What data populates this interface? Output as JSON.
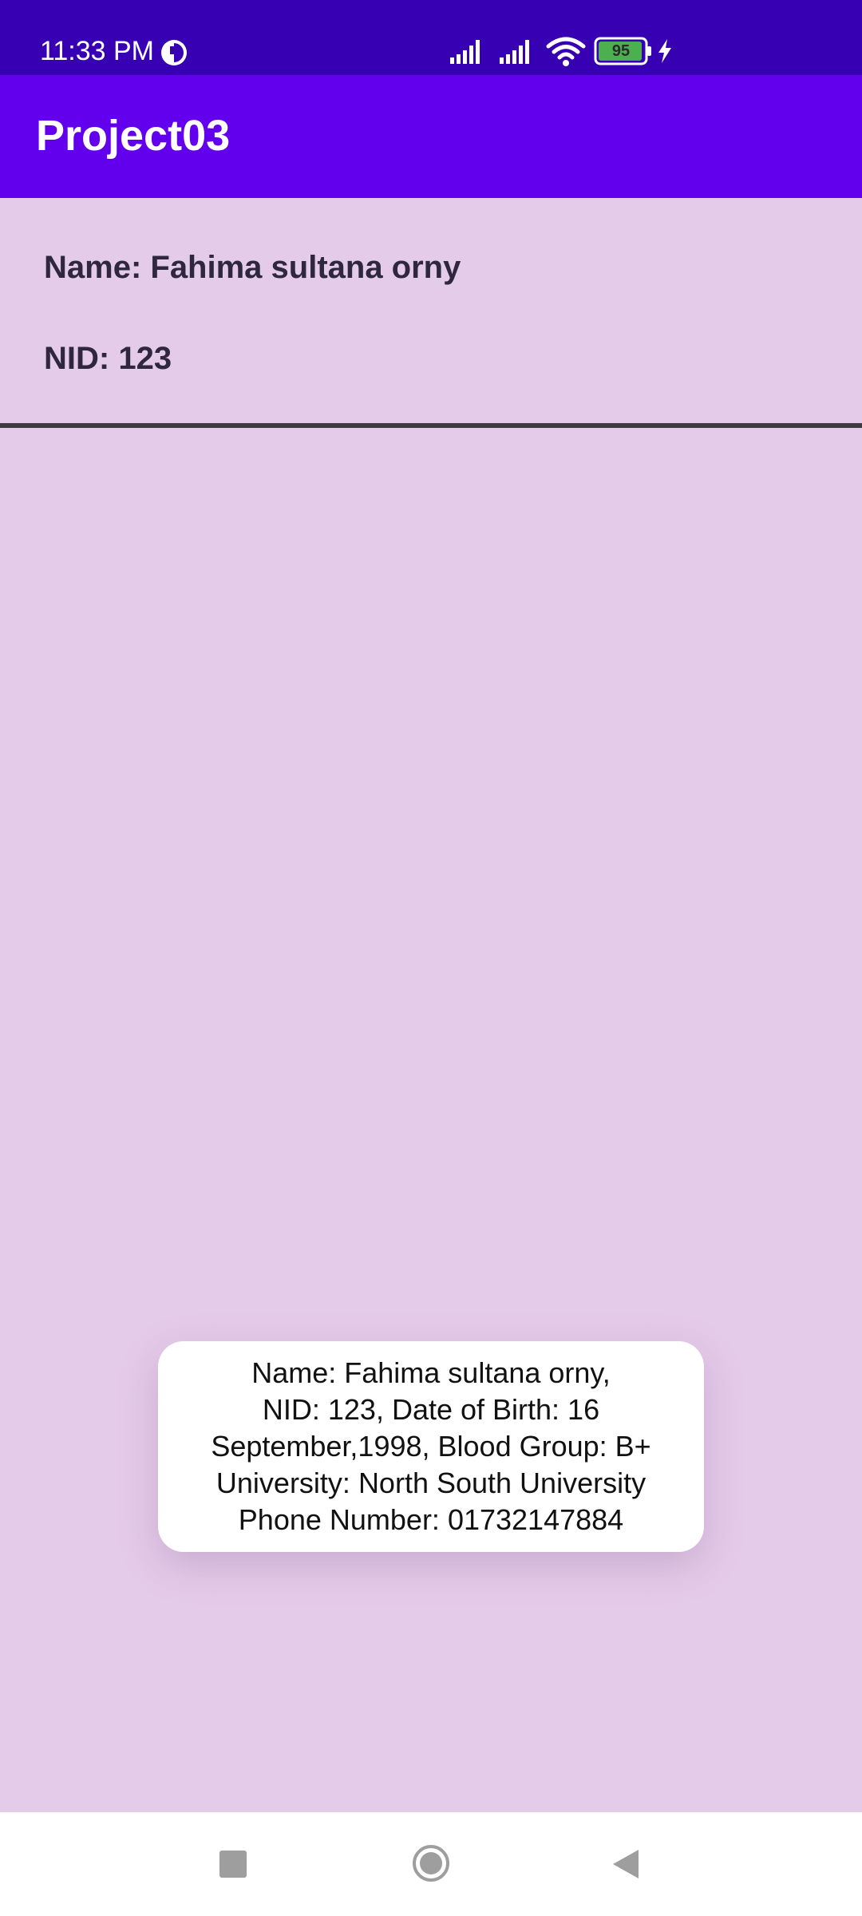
{
  "status_bar": {
    "time": "11:33 PM",
    "battery_level": "95",
    "icons": [
      "clock-badge-icon",
      "signal-icon",
      "signal-icon",
      "wifi-icon",
      "battery-icon",
      "charging-icon"
    ],
    "battery_color": "#4caf50"
  },
  "app_bar": {
    "title": "Project03",
    "color": "#6200ee"
  },
  "info": {
    "name_line": "Name: Fahima sultana orny",
    "nid_line": "NID: 123"
  },
  "toast": {
    "text": "Name: Fahima sultana orny,\nNID: 123, Date of Birth: 16\nSeptember,1998, Blood Group: B+\nUniversity: North South University\nPhone Number: 01732147884"
  },
  "nav_bar": {
    "buttons": [
      "recent-apps-button",
      "home-button",
      "back-button"
    ]
  },
  "colors": {
    "status_bar": "#3700b3",
    "background": "#e5cbea",
    "text": "#2f2740"
  }
}
